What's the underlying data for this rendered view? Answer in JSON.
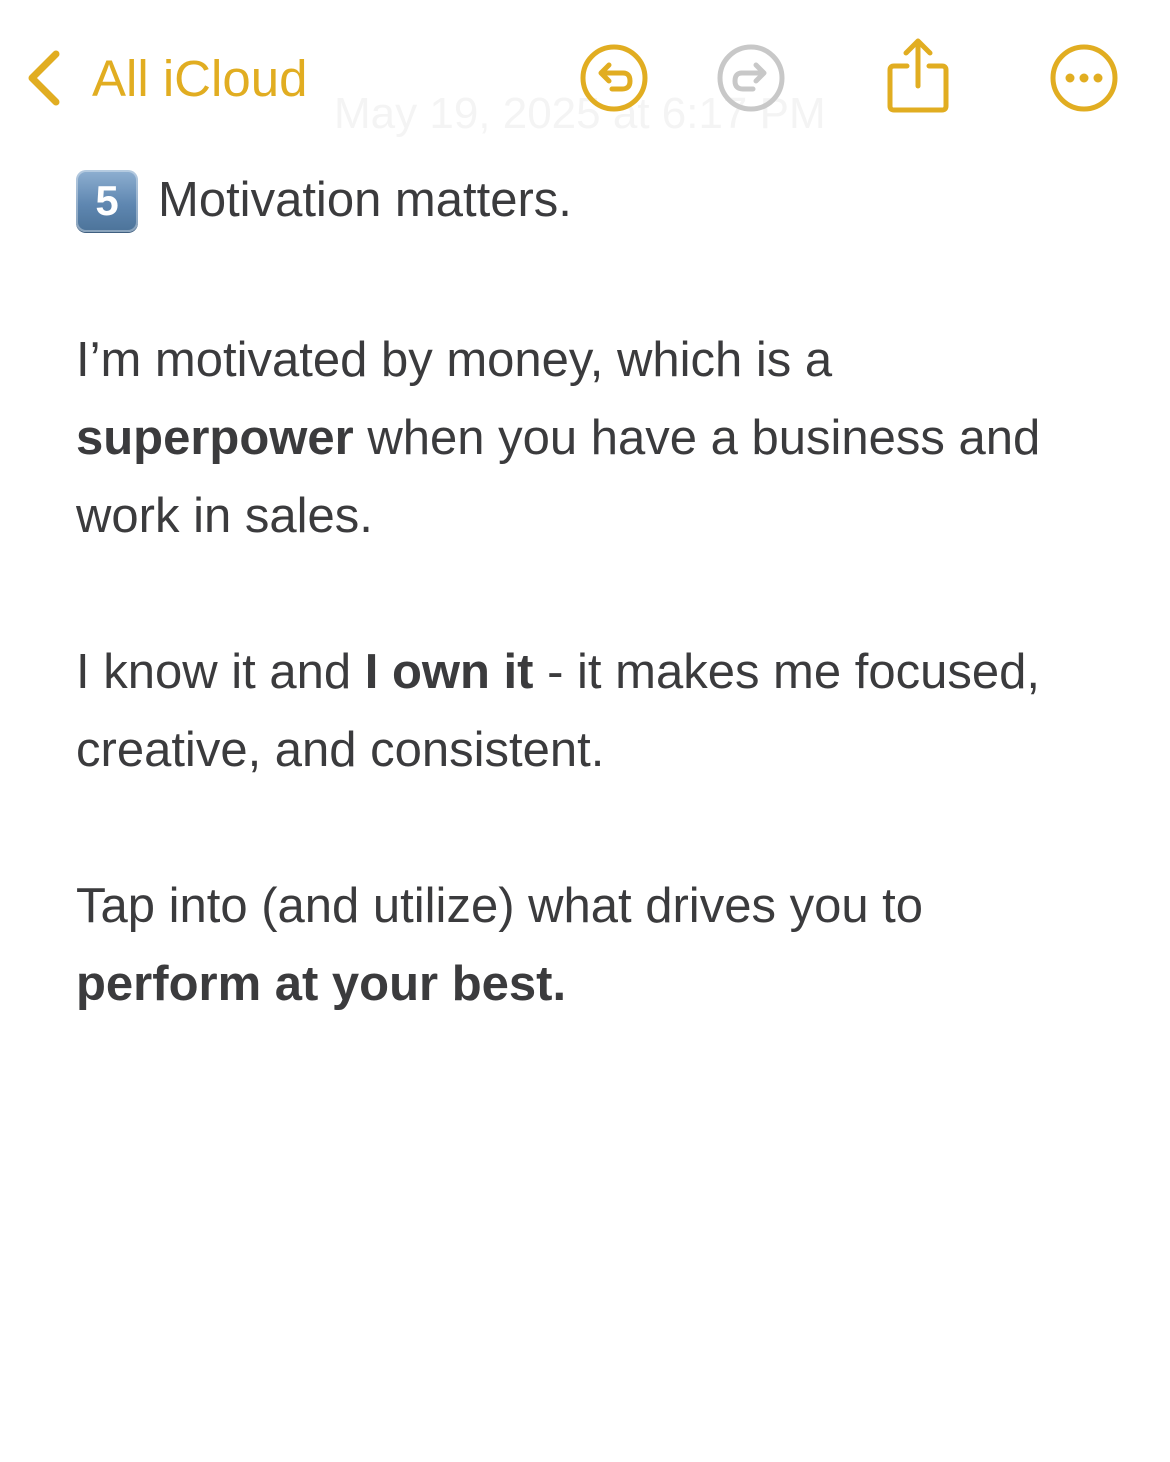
{
  "nav": {
    "back_label": "All iCloud",
    "timestamp": "May 19, 2025 at 6:17 PM",
    "icons": {
      "back": "chevron-left-icon",
      "undo": "undo-icon",
      "redo": "redo-icon",
      "share": "share-icon",
      "more": "ellipsis-circle-icon"
    },
    "colors": {
      "accent": "#e1ad21",
      "disabled": "#c8c8c8"
    }
  },
  "note": {
    "heading": {
      "keycap_digit": "5",
      "keycap_icon": "keycap-digit-five-emoji",
      "text": "Motivation matters."
    },
    "para1": {
      "part1": "I’m motivated by money, which is a",
      "bold1": "superpower",
      "part2": " when you have a business and work in sales."
    },
    "para2": {
      "part1": "I know it and ",
      "bold1": "I own it",
      "part2": " - it makes me focused, creative, and consistent."
    },
    "para3": {
      "part1": "Tap into (and utilize) what drives you to",
      "bold1": "perform at your best."
    },
    "text_color": "#3b3b3d"
  }
}
